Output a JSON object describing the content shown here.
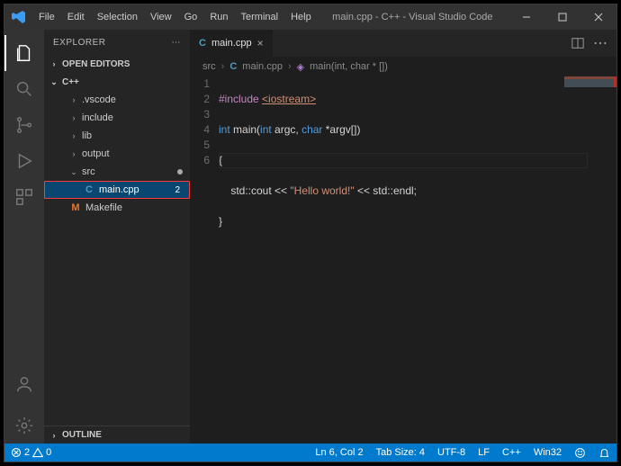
{
  "titlebar": {
    "menu": [
      "File",
      "Edit",
      "Selection",
      "View",
      "Go",
      "Run",
      "Terminal",
      "Help"
    ],
    "title": "main.cpp - C++ - Visual Studio Code"
  },
  "explorer": {
    "header": "EXPLORER",
    "open_editors": "OPEN EDITORS",
    "root": "C++",
    "folders": [
      {
        "name": ".vscode"
      },
      {
        "name": "include"
      },
      {
        "name": "lib"
      },
      {
        "name": "output"
      }
    ],
    "src_folder": {
      "name": "src",
      "modified": true
    },
    "main_file": {
      "name": "main.cpp",
      "badge": "2"
    },
    "makefile": {
      "name": "Makefile"
    },
    "outline": "OUTLINE"
  },
  "tab": {
    "label": "main.cpp"
  },
  "breadcrumb": {
    "a": "src",
    "b": "main.cpp",
    "c": "main(int, char * [])"
  },
  "code": {
    "line1_a": "#include ",
    "line1_b": "<iostream>",
    "line2_a": "int",
    "line2_b": " main(",
    "line2_c": "int",
    "line2_d": " argc, ",
    "line2_e": "char",
    "line2_f": " *argv[])",
    "line3": "{",
    "line4_a": "    std::cout << ",
    "line4_b": "\"Hello world!\"",
    "line4_c": " << std::endl;",
    "line5": "}",
    "gutter": [
      "1",
      "2",
      "3",
      "4",
      "5",
      "6"
    ]
  },
  "status": {
    "errors": "2",
    "warnings": "0",
    "ln_col": "Ln 6, Col 2",
    "tab_size": "Tab Size: 4",
    "encoding": "UTF-8",
    "eol": "LF",
    "lang": "C++",
    "platform": "Win32"
  }
}
